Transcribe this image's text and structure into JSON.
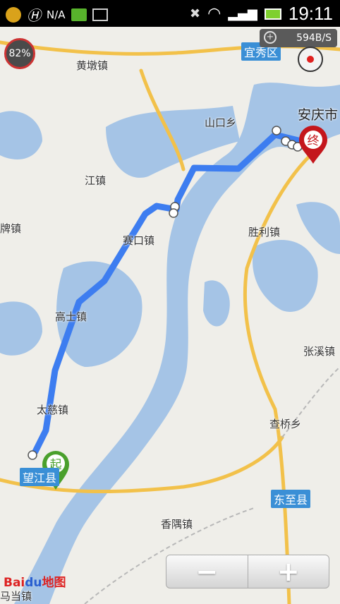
{
  "status_bar": {
    "carrier": "N/A",
    "time": "19:11"
  },
  "map": {
    "battery_percent": "82%",
    "network_speed": "594B/S",
    "place_labels": {
      "huangdun": "黄墩镇",
      "yixiu": "宜秀区",
      "shankou": "山口乡",
      "anqing": "安庆市",
      "jiangzhen": "江镇",
      "paizhen": "牌镇",
      "saikou": "赛口镇",
      "shengli": "胜利镇",
      "gaoshi": "高士镇",
      "zhangxi": "张溪镇",
      "taici": "太慈镇",
      "chaqiao": "查桥乡",
      "wangjiang": "望江县",
      "dongzhi": "东至县",
      "xiangyu": "香隅镇",
      "madang": "马当镇"
    },
    "start_marker": "起",
    "end_marker": "终",
    "zoom_out": "−",
    "zoom_in": "+",
    "logo_bai": "Bai",
    "logo_du": "du",
    "logo_map": "地图"
  },
  "colors": {
    "route": "#3d7df0",
    "water": "#a5c4e6",
    "road": "#f2c14a",
    "start": "#4aa02c",
    "end": "#c4161c"
  }
}
